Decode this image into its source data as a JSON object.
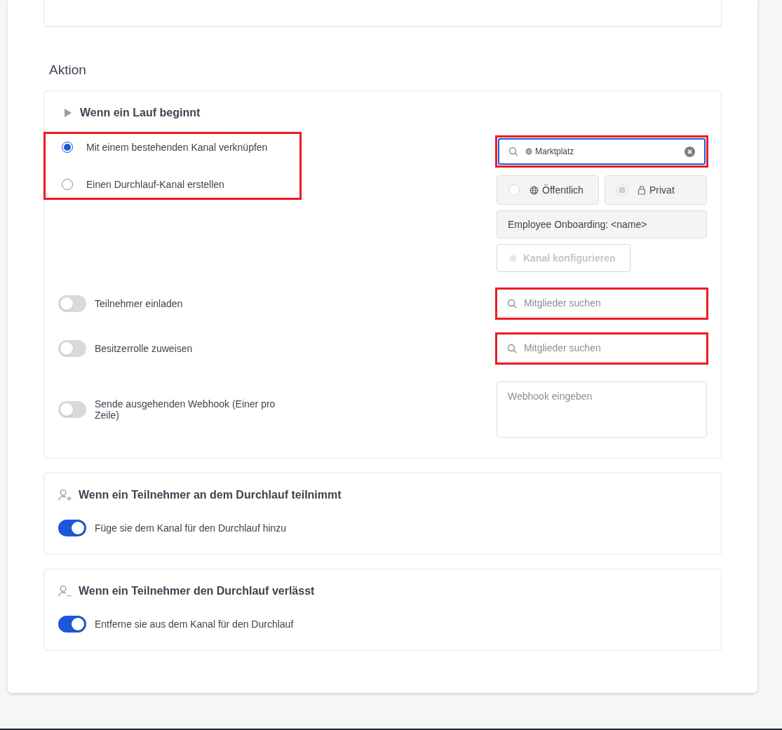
{
  "section_title": "Aktion",
  "run_start": {
    "title": "Wenn ein Lauf beginnt",
    "channel_options": {
      "highlighted": true,
      "items": [
        {
          "label": "Mit einem bestehenden Kanal verknüpfen",
          "selected": true
        },
        {
          "label": "Einen Durchlauf-Kanal erstellen",
          "selected": false
        }
      ]
    },
    "channel_search": {
      "highlighted": true,
      "value": "Marktplatz"
    },
    "visibility": [
      {
        "kind": "public",
        "label": "Öffentlich",
        "selected": false
      },
      {
        "kind": "private",
        "label": "Privat",
        "selected": true
      }
    ],
    "channel_name": {
      "value": "Employee Onboarding: <name>"
    },
    "configure_button": {
      "label": "Kanal konfigurieren",
      "disabled": true
    },
    "toggles": [
      {
        "label": "Teilnehmer einladen",
        "on": false,
        "field": {
          "kind": "search",
          "placeholder": "Mitglieder suchen",
          "highlighted": true
        }
      },
      {
        "label": "Besitzerrolle zuweisen",
        "on": false,
        "field": {
          "kind": "search",
          "placeholder": "Mitglieder suchen",
          "highlighted": true
        }
      },
      {
        "label": "Sende ausgehenden Webhook (Einer pro Zeile)",
        "on": false,
        "field": {
          "kind": "textarea",
          "placeholder": "Webhook eingeben",
          "highlighted": false
        }
      }
    ]
  },
  "participant_cards": [
    {
      "kind": "join",
      "title": "Wenn ein Teilnehmer an dem Durchlauf teilnimmt",
      "toggle": {
        "label": "Füge sie dem Kanal für den Durchlauf hinzu",
        "on": true
      }
    },
    {
      "kind": "leave",
      "title": "Wenn ein Teilnehmer den Durchlauf verlässt",
      "toggle": {
        "label": "Entferne sie aus dem Kanal für den Durchlauf",
        "on": true
      }
    }
  ]
}
